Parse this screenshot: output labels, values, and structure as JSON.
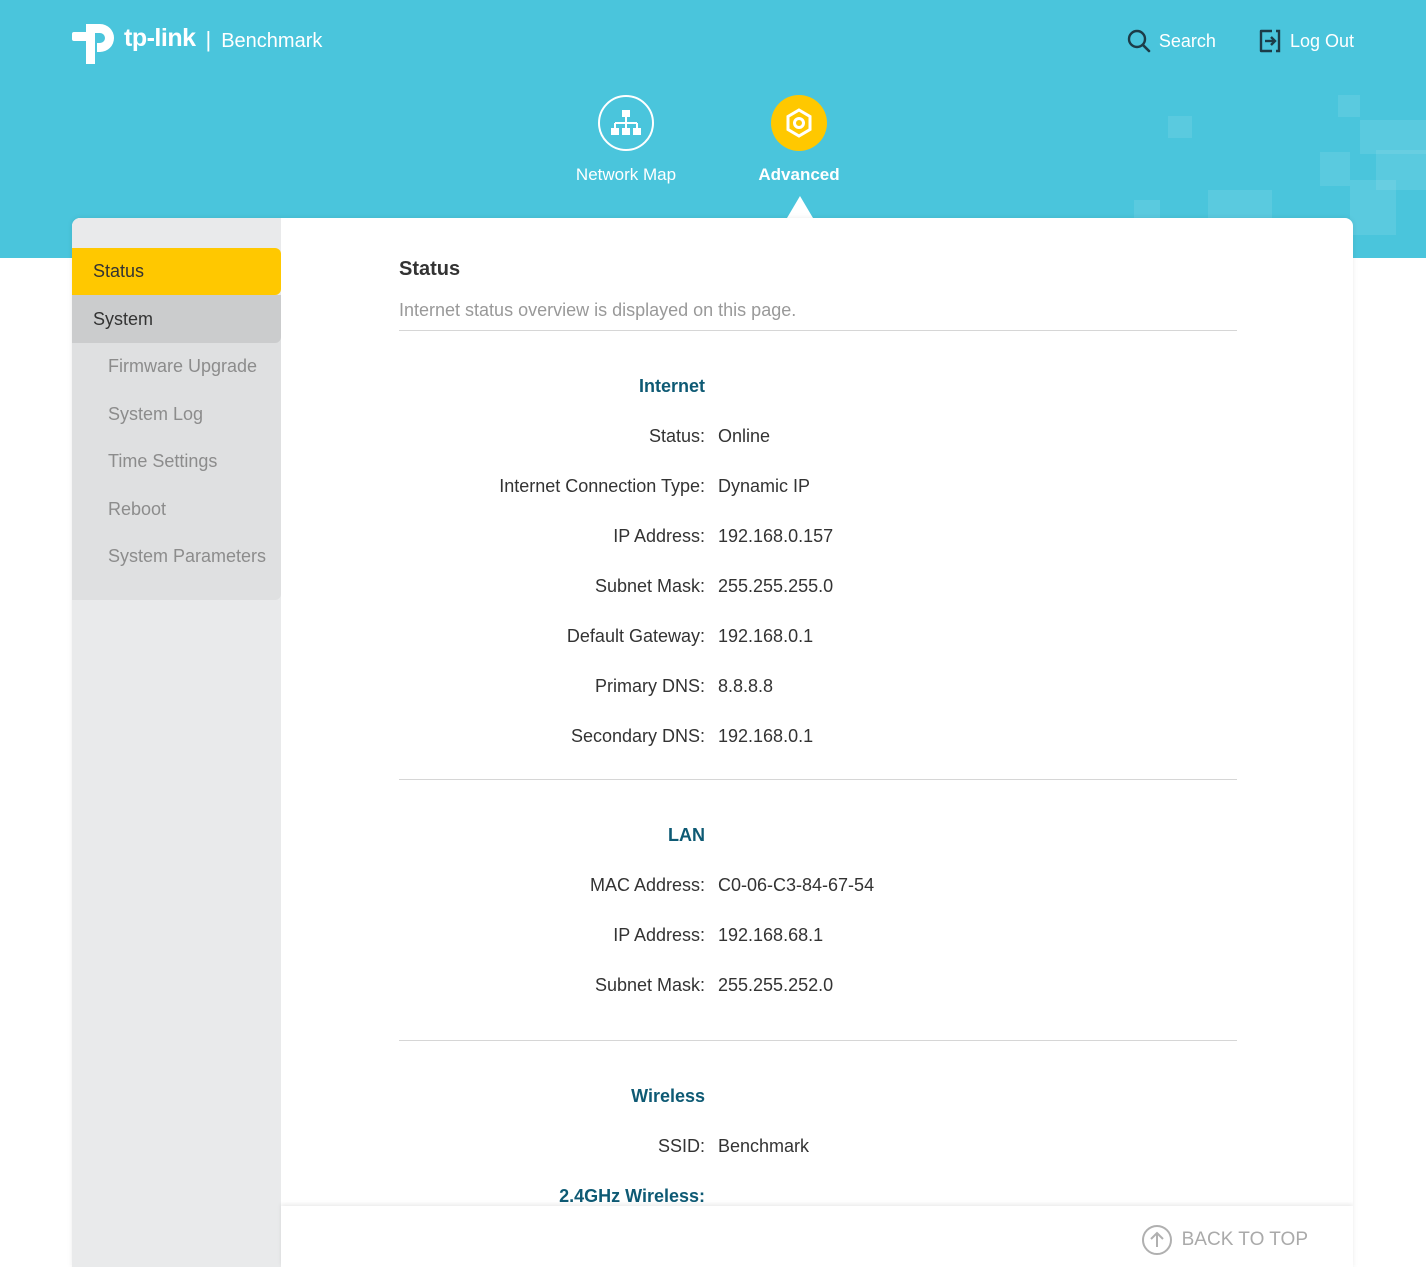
{
  "header": {
    "brand": "tp-link",
    "model": "Benchmark",
    "separator": "|",
    "search_label": "Search",
    "logout_label": "Log Out",
    "colors": {
      "band": "#4ac5dc",
      "accent": "#ffc800"
    }
  },
  "nav": [
    {
      "label": "Network Map",
      "icon": "network-map-icon",
      "active": false
    },
    {
      "label": "Advanced",
      "icon": "advanced-gear-icon",
      "active": true
    }
  ],
  "sidebar": {
    "status": "Status",
    "system": "System",
    "system_items": [
      "Firmware Upgrade",
      "System Log",
      "Time Settings",
      "Reboot",
      "System Parameters"
    ]
  },
  "main": {
    "title": "Status",
    "description": "Internet status overview is displayed on this page.",
    "internet": {
      "heading": "Internet",
      "rows": [
        {
          "label": "Status:",
          "value": "Online"
        },
        {
          "label": "Internet Connection Type:",
          "value": "Dynamic IP"
        },
        {
          "label": "IP Address:",
          "value": "192.168.0.157"
        },
        {
          "label": "Subnet Mask:",
          "value": "255.255.255.0"
        },
        {
          "label": "Default Gateway:",
          "value": "192.168.0.1"
        },
        {
          "label": "Primary DNS:",
          "value": "8.8.8.8"
        },
        {
          "label": "Secondary DNS:",
          "value": "192.168.0.1"
        }
      ]
    },
    "lan": {
      "heading": "LAN",
      "rows": [
        {
          "label": "MAC Address:",
          "value": "C0-06-C3-84-67-54"
        },
        {
          "label": "IP Address:",
          "value": "192.168.68.1"
        },
        {
          "label": "Subnet Mask:",
          "value": "255.255.252.0"
        }
      ]
    },
    "wireless": {
      "heading": "Wireless",
      "rows": [
        {
          "label": "SSID:",
          "value": "Benchmark"
        }
      ],
      "sub_heading": "2.4GHz Wireless:"
    }
  },
  "footer": {
    "back_to_top": "BACK TO TOP"
  }
}
